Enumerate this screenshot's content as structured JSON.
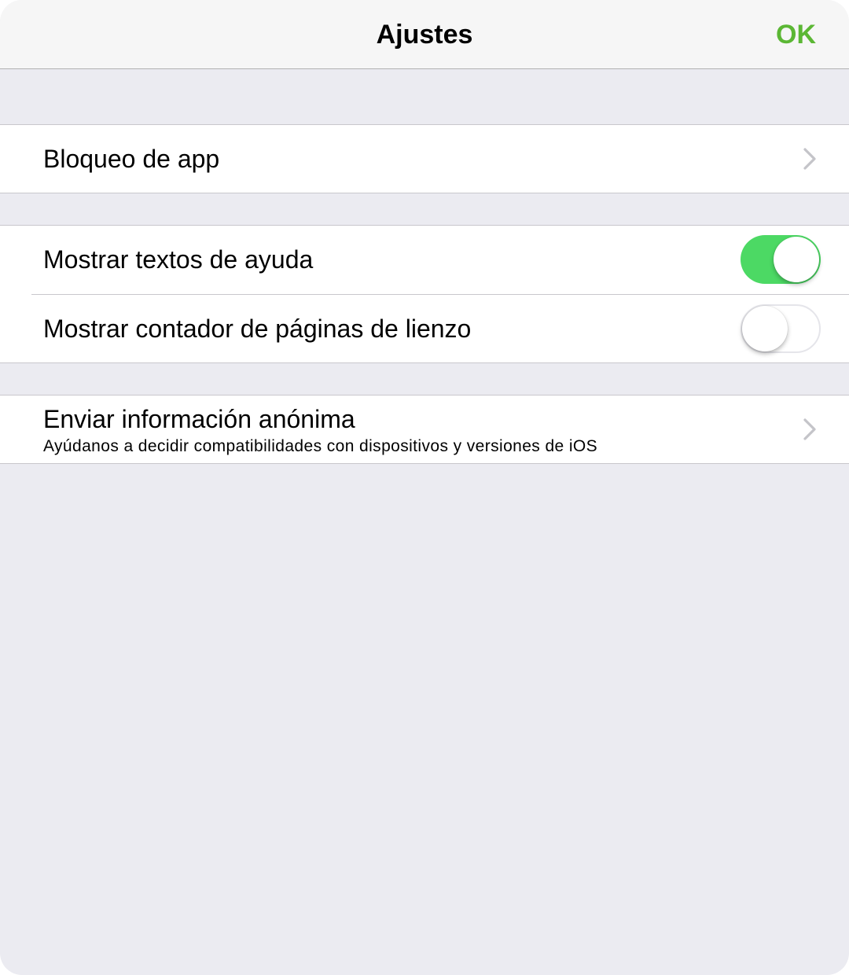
{
  "navbar": {
    "title": "Ajustes",
    "ok_label": "OK"
  },
  "colors": {
    "accent": "#5bb734",
    "toggle_on": "#4cd964",
    "background": "#ebebf1"
  },
  "sections": {
    "app_lock": {
      "label": "Bloqueo de app",
      "icon": "chevron-right-icon"
    },
    "display": {
      "help_texts": {
        "label": "Mostrar textos de ayuda",
        "enabled": true
      },
      "page_counter": {
        "label": "Mostrar contador de páginas de lienzo",
        "enabled": false
      }
    },
    "analytics": {
      "title": "Enviar información anónima",
      "subtitle": "Ayúdanos a decidir compatibilidades con dispositivos y versiones de iOS",
      "icon": "chevron-right-icon"
    }
  }
}
